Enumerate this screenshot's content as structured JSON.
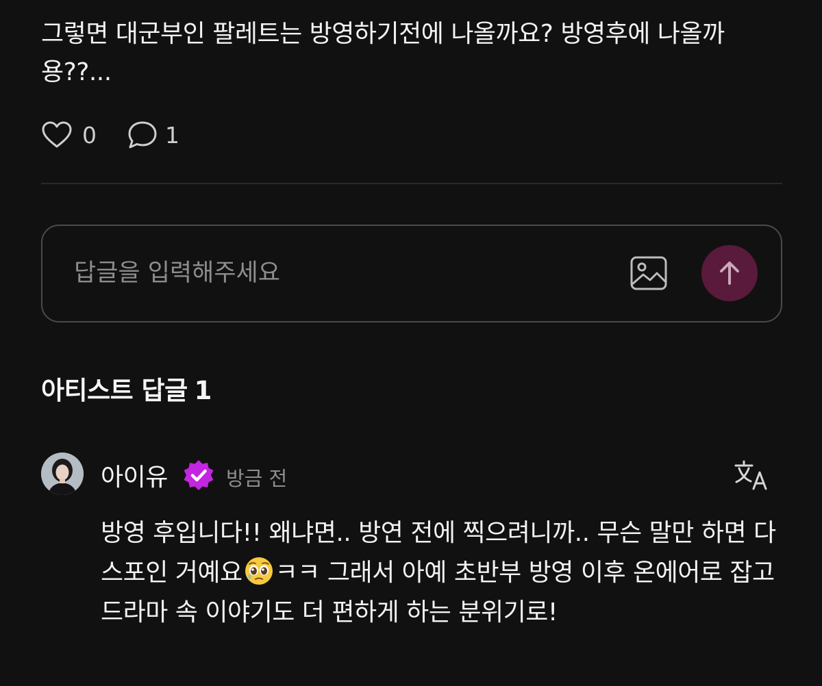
{
  "post": {
    "text": "그렇면 대군부인 팔레트는 방영하기전에 나올까요? 방영후에 나올까용??...",
    "like_count": "0",
    "comment_count": "1",
    "icons": {
      "like": "heart-outline-icon",
      "comment": "speech-bubble-icon"
    }
  },
  "reply_box": {
    "placeholder": "답글을 입력해주세요",
    "value": "",
    "icons": {
      "image": "image-icon",
      "send": "arrow-up-icon"
    },
    "send_button_color": "#5a1a3c"
  },
  "artist_replies": {
    "title": "아티스트 답글",
    "count": "1"
  },
  "reply": {
    "author": "아이유",
    "verified_badge_color": "#c326e0",
    "timestamp": "방금 전",
    "text_before_emoji": "방영 후입니다!! 왜냐면.. 방연 전에 찍으려니까.. 무슨 말만 하면 다 스포인 거예요",
    "emoji": "pleading-face-emoji",
    "text_after_emoji": "ㅋㅋ 그래서 아예 초반부 방영 이후 온에어로 잡고 드라마 속 이야기도 더 편하게 하는 분위기로!",
    "icons": {
      "translate": "translate-icon",
      "avatar": "profile-photo"
    }
  },
  "colors": {
    "background": "#121111",
    "text": "#f2f2f2",
    "muted": "#8e8e8e",
    "border": "#4a4a4a"
  }
}
